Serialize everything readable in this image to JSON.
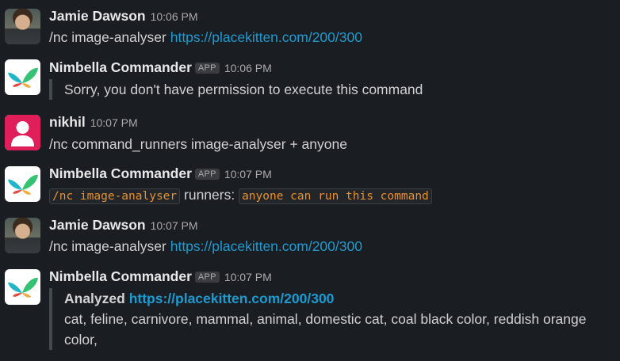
{
  "messages": [
    {
      "author": "Jamie Dawson",
      "time": "10:06 PM",
      "command": "/nc image-analyser ",
      "link": "https://placekitten.com/200/300"
    },
    {
      "author": "Nimbella Commander",
      "badge": "APP",
      "time": "10:06 PM",
      "text": "Sorry, you don't have permission to execute this command"
    },
    {
      "author": "nikhil",
      "time": "10:07 PM",
      "text": "/nc command_runners image-analyser + anyone"
    },
    {
      "author": "Nimbella Commander",
      "badge": "APP",
      "time": "10:07 PM",
      "code1": "/nc image-analyser",
      "middle": " runners: ",
      "code2": "anyone can run this command"
    },
    {
      "author": "Jamie Dawson",
      "time": "10:07 PM",
      "command": "/nc image-analyser ",
      "link": "https://placekitten.com/200/300"
    },
    {
      "author": "Nimbella Commander",
      "badge": "APP",
      "time": "10:07 PM",
      "label": "Analyzed ",
      "link": "https://placekitten.com/200/300",
      "tags_line1": "cat, feline, carnivore, mammal, animal, domestic cat, coal black color, reddish orange",
      "tags_line2": "color,"
    }
  ],
  "colors": {
    "background": "#1a1d21",
    "link": "#1d9bd1",
    "code": "#e8912d",
    "user_avatar": "#e01e5a"
  },
  "icons": {
    "app": "nimbella-butterfly-logo",
    "user": "person-silhouette-icon"
  }
}
